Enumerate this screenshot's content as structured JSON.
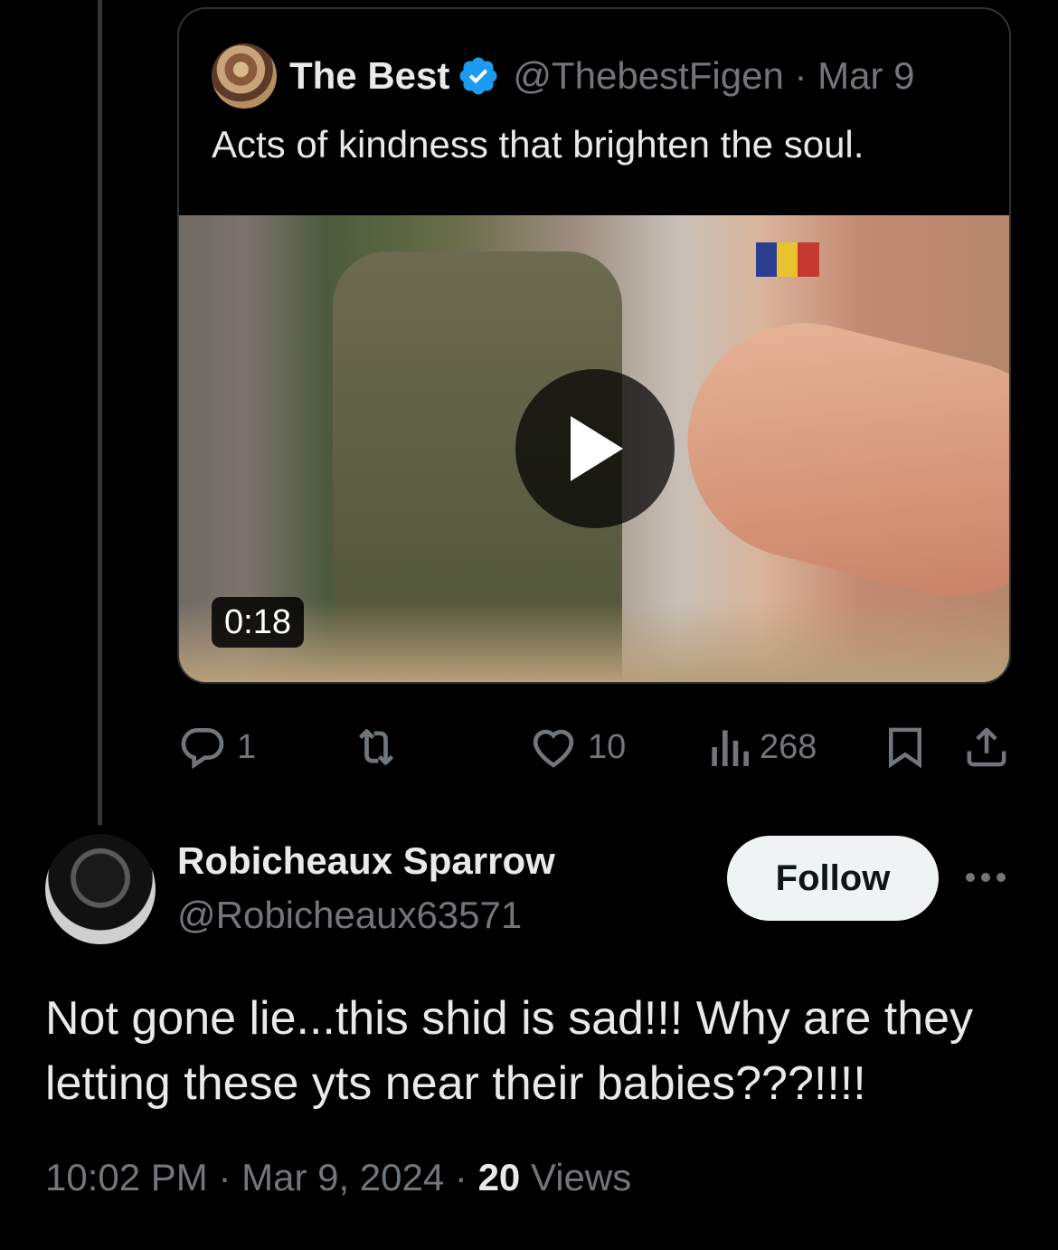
{
  "quoted": {
    "name": "The Best",
    "handle_date": "@ThebestFigen · Mar 9",
    "text": "Acts of kindness that brighten the soul.",
    "video_duration": "0:18"
  },
  "actions": {
    "replies": "1",
    "reposts": "",
    "likes": "10",
    "views": "268"
  },
  "reply": {
    "name": "Robicheaux Sparrow",
    "handle": "@Robicheaux63571",
    "follow_label": "Follow",
    "text": "Not gone lie...this shid is sad!!! Why are they letting these yts near their babies???!!!!",
    "time_date": "10:02 PM · Mar 9, 2024 · ",
    "views_count": "20",
    "views_label": " Views"
  },
  "icons": {
    "verified": "verified-badge-icon",
    "reply": "reply-icon",
    "repost": "repost-icon",
    "like": "heart-icon",
    "views": "views-chart-icon",
    "bookmark": "bookmark-icon",
    "share": "share-icon",
    "more": "more-dots-icon",
    "play": "play-icon"
  },
  "colors": {
    "background": "#000000",
    "text_primary": "#e7e9ea",
    "text_secondary": "#71767b",
    "verified_blue": "#1d9bf0",
    "follow_bg": "#eff3f4"
  }
}
